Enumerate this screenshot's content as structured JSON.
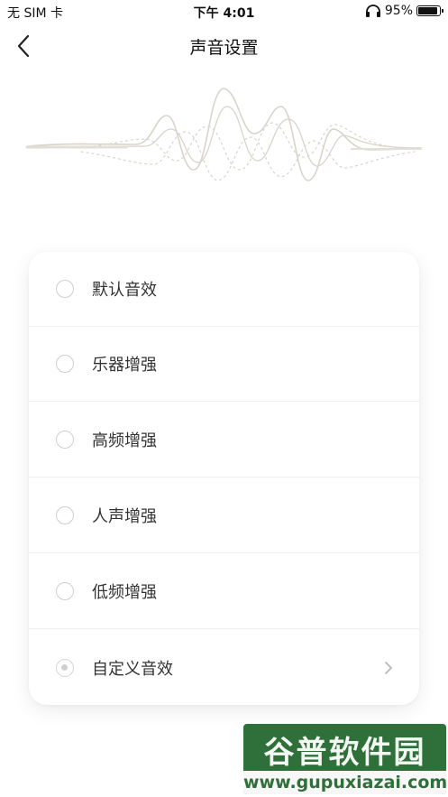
{
  "status_bar": {
    "carrier": "无 SIM 卡",
    "time": "下午 4:01",
    "battery_percent": "95%",
    "battery_level": 0.95
  },
  "nav": {
    "title": "声音设置",
    "back_icon": "chevron-left-icon"
  },
  "options": [
    {
      "label": "默认音效",
      "selected": false
    },
    {
      "label": "乐器增强",
      "selected": false
    },
    {
      "label": "高频增强",
      "selected": false
    },
    {
      "label": "人声增强",
      "selected": false
    },
    {
      "label": "低频增强",
      "selected": false
    },
    {
      "label": "自定义音效",
      "selected": true,
      "has_chevron": true
    }
  ],
  "watermark": {
    "name": "谷普软件园",
    "url": "www.gupuxiazai.com"
  },
  "colors": {
    "wave": "#d8d4cc",
    "watermark_green": "#2f6f3a"
  }
}
